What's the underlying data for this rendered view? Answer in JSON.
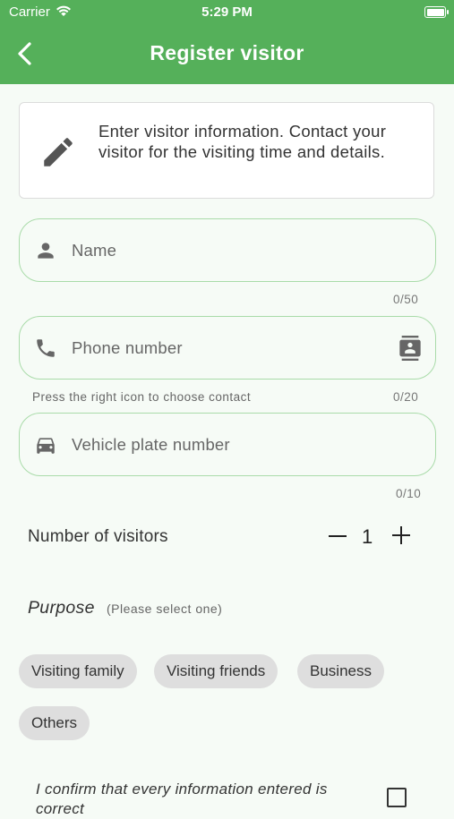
{
  "status_bar": {
    "carrier": "Carrier",
    "time": "5:29 PM"
  },
  "header": {
    "title": "Register visitor",
    "back_icon": "chevron-left-icon"
  },
  "info_card": {
    "icon": "pencil-icon",
    "text": "Enter visitor information. Contact your visitor for the visiting time and details."
  },
  "fields": {
    "name": {
      "placeholder": "Name",
      "counter": "0/50",
      "icon": "person-icon"
    },
    "phone": {
      "placeholder": "Phone number",
      "counter": "0/20",
      "helper": "Press the right icon to choose contact",
      "icon": "phone-icon",
      "action_icon": "contact-book-icon"
    },
    "vehicle": {
      "placeholder": "Vehicle plate number",
      "counter": "0/10",
      "icon": "car-icon"
    }
  },
  "visitors": {
    "label": "Number of visitors",
    "value": "1"
  },
  "purpose": {
    "label": "Purpose",
    "hint": "(Please select one)",
    "options": [
      "Visiting family",
      "Visiting friends",
      "Business",
      "Others"
    ]
  },
  "confirm": {
    "text": "I confirm that every information entered is correct"
  },
  "colors": {
    "header": "#55b05a",
    "field_border": "#a9dba9",
    "chip": "#dedede",
    "background": "#f6fbf6"
  }
}
